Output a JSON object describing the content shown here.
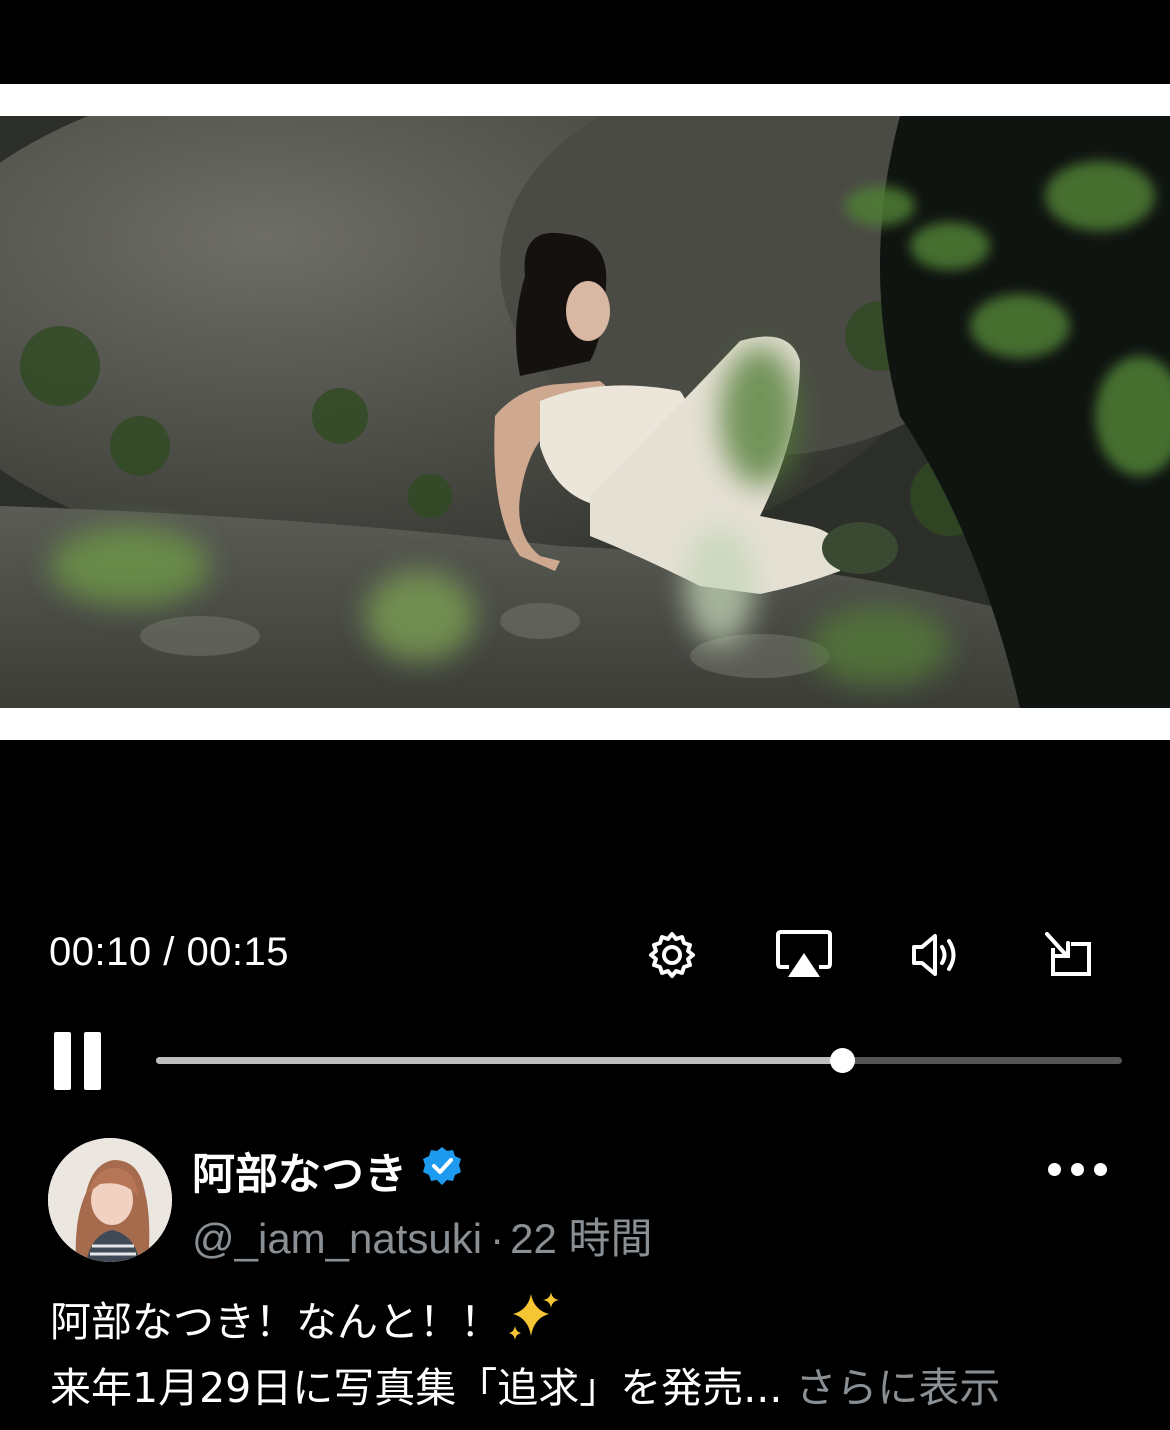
{
  "player": {
    "time": "00:10 / 00:15",
    "progress_fraction": 0.71,
    "icons": [
      "gear-icon",
      "airplay-icon",
      "speaker-icon",
      "exit-fullscreen-icon",
      "pause-icon"
    ]
  },
  "post": {
    "author_name": "阿部なつき",
    "verified": true,
    "handle": "@_iam_natsuki",
    "separator": "·",
    "time_ago": "22 時間",
    "line1": "阿部なつき！なんと！！",
    "line1_emoji": "✨",
    "line2": "来年1月29日に写真集「追求」を発売...",
    "show_more": " さらに表示"
  },
  "colors": {
    "background": "#000000",
    "verified_badge": "#1d9bf0",
    "muted_text": "#8a8f94",
    "progress_fill": "#bdbdbd",
    "progress_track": "#555555"
  }
}
